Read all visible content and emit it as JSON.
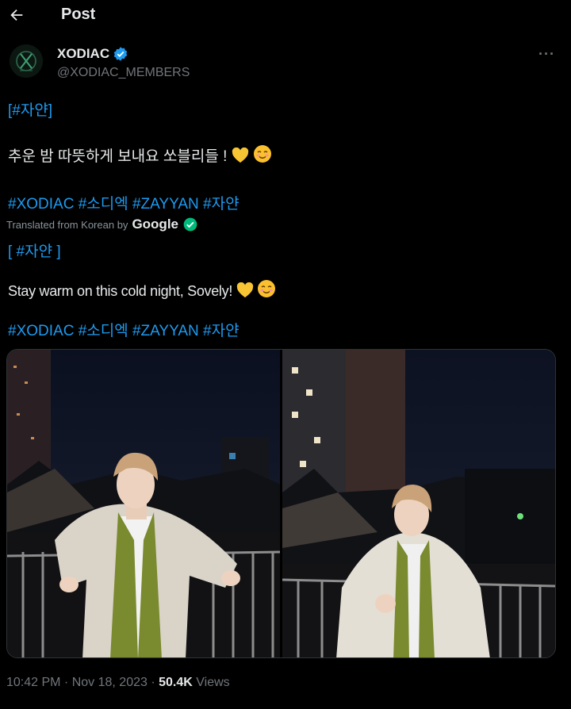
{
  "topbar": {
    "title": "Post",
    "back_icon": "arrow-left-icon"
  },
  "author": {
    "name": "XODIAC",
    "handle": "@XODIAC_MEMBERS",
    "verified_color": "#1d9bf0",
    "more_label": "···"
  },
  "post": {
    "original": {
      "tag_line_1": "[#자얀]",
      "body": "추운 밤 따뜻하게 보내요 쏘블리들 !",
      "hashtags": "#XODIAC #소디엑 #ZAYYAN #자얀"
    },
    "translation": {
      "label": "Translated from Korean by",
      "provider": "Google",
      "tag_line": "[ #자얀 ]",
      "body": "Stay warm on this cold night, Sovely!",
      "hashtags": "#XODIAC #소디엑 #ZAYYAN #자얀"
    }
  },
  "meta": {
    "time": "10:42 PM · Nov 18, 2023 · ",
    "views_count": "50.4K",
    "views_label": " Views"
  },
  "colors": {
    "link": "#1d9bf0",
    "muted": "#71767b",
    "text": "#e7e9ea",
    "background": "#000000"
  }
}
